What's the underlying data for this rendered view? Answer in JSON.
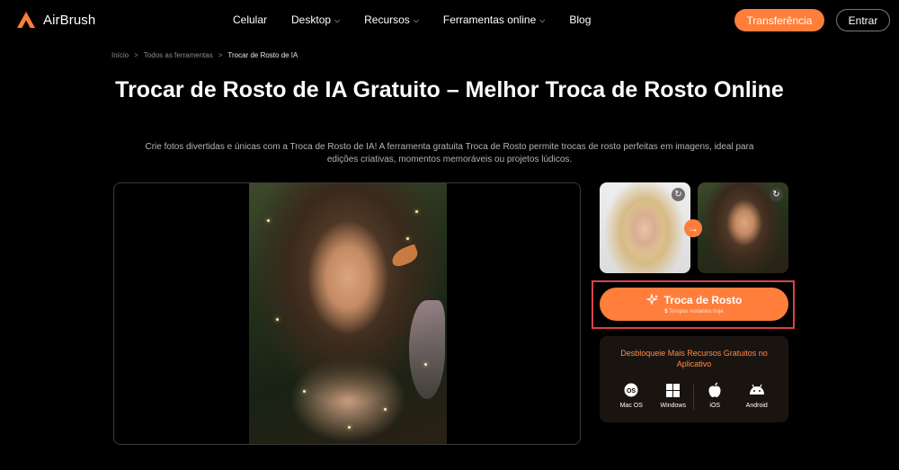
{
  "header": {
    "logo_text": "AirBrush",
    "nav": [
      {
        "label": "Celular",
        "dropdown": false
      },
      {
        "label": "Desktop",
        "dropdown": true
      },
      {
        "label": "Recursos",
        "dropdown": true
      },
      {
        "label": "Ferramentas online",
        "dropdown": true
      },
      {
        "label": "Blog",
        "dropdown": false
      }
    ],
    "transfer_label": "Transferência",
    "login_label": "Entrar"
  },
  "breadcrumb": {
    "home": "Início",
    "tools": "Todos as ferramentas",
    "current": "Trocar de Rosto de IA",
    "separator": ">"
  },
  "page": {
    "title": "Trocar de Rosto de IA Gratuito – Melhor Troca de Rosto Online",
    "subtitle": "Crie fotos divertidas e únicas com a Troca de Rosto de IA! A ferramenta gratuita Troca de Rosto permite trocas de rosto perfeitas em imagens, ideal para edições criativas, momentos memoráveis ou projetos lúdicos."
  },
  "swap": {
    "label": "Troca de Rosto",
    "remaining_count": "5",
    "remaining_text": "Tempos restantes hoje"
  },
  "download": {
    "title": "Desbloqueie Mais Recursos Gratuitos no Aplicativo",
    "platforms": [
      {
        "label": "Mac OS",
        "icon": "macos-icon"
      },
      {
        "label": "Windows",
        "icon": "windows-icon"
      },
      {
        "label": "iOS",
        "icon": "apple-icon"
      },
      {
        "label": "Android",
        "icon": "android-icon"
      }
    ]
  },
  "colors": {
    "accent": "#ff7e3b",
    "highlight_frame": "#d9434a",
    "background": "#000000"
  }
}
